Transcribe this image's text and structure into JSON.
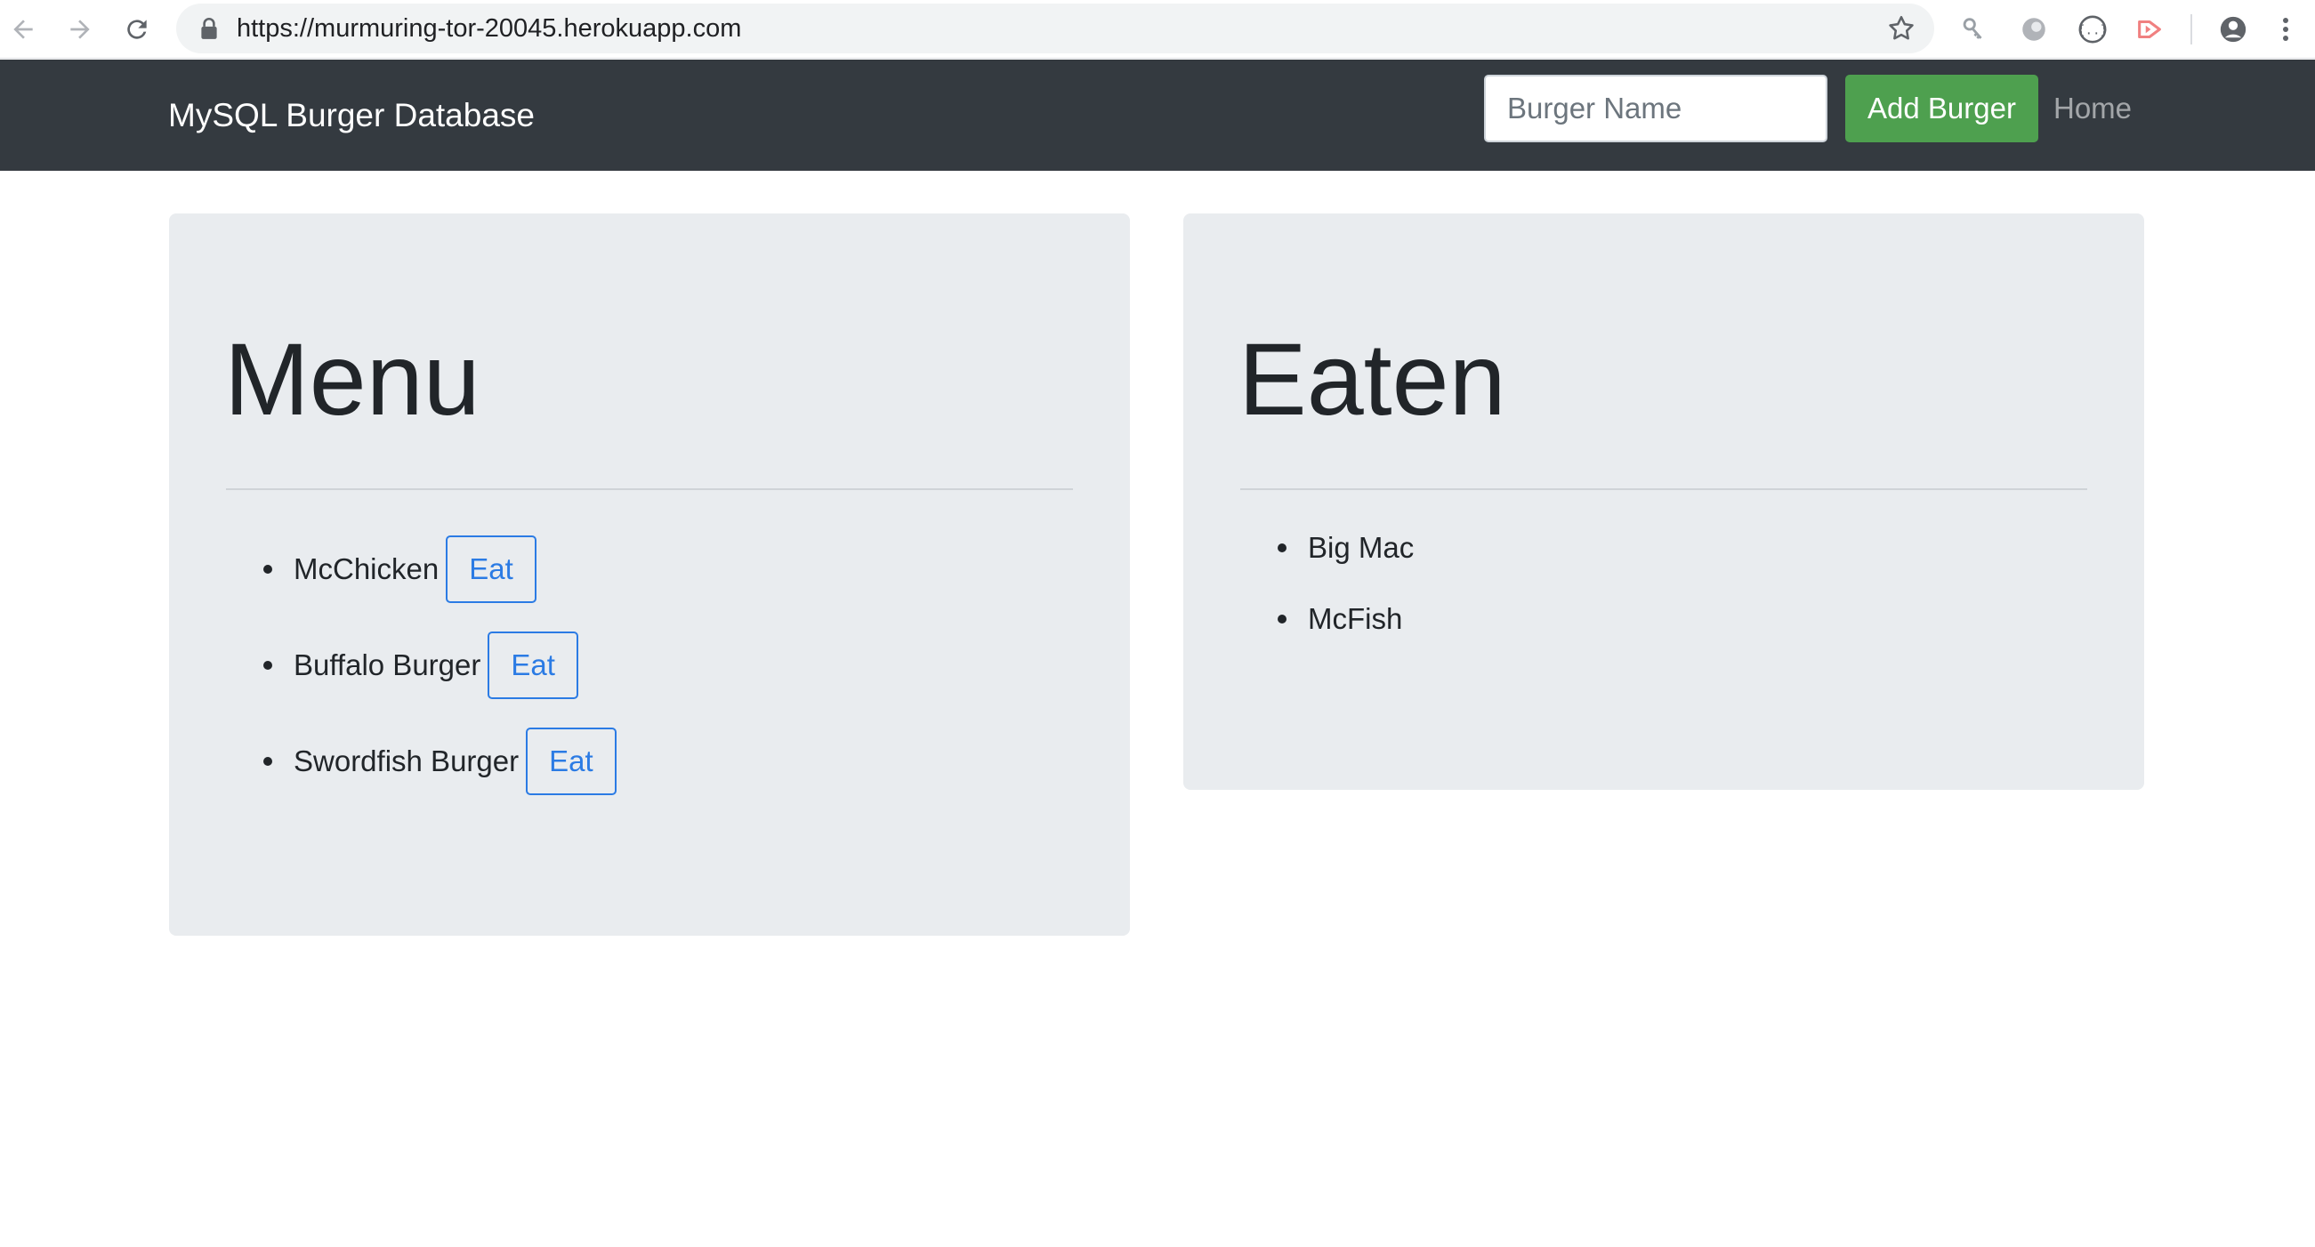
{
  "browser": {
    "url": "https://murmuring-tor-20045.herokuapp.com",
    "icons": {
      "back": "back-arrow-icon",
      "forward": "forward-arrow-icon",
      "reload": "reload-icon",
      "lock": "lock-icon",
      "bookmark": "star-icon",
      "profile": "profile-avatar-icon",
      "menu": "kebab-menu-icon"
    }
  },
  "navbar": {
    "brand": "MySQL Burger Database",
    "input_placeholder": "Burger Name",
    "input_value": "",
    "add_button_label": "Add Burger",
    "home_link": "Home"
  },
  "menu": {
    "title": "Menu",
    "items": [
      {
        "name": "McChicken",
        "button": "Eat"
      },
      {
        "name": "Buffalo Burger",
        "button": "Eat"
      },
      {
        "name": "Swordfish Burger",
        "button": "Eat"
      }
    ]
  },
  "eaten": {
    "title": "Eaten",
    "items": [
      {
        "name": "Big Mac"
      },
      {
        "name": "McFish"
      }
    ]
  },
  "colors": {
    "navbar_bg": "#343a40",
    "panel_bg": "#e9ecef",
    "add_button": "#4ea04f",
    "eat_button": "#2b7be4"
  }
}
